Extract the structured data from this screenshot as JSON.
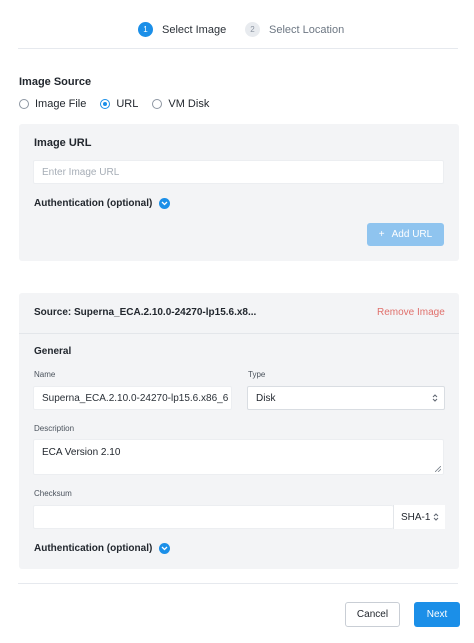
{
  "stepper": {
    "steps": [
      {
        "num": "1",
        "label": "Select Image",
        "state": "active"
      },
      {
        "num": "2",
        "label": "Select Location",
        "state": "inactive"
      }
    ]
  },
  "image_source": {
    "title": "Image Source",
    "options": [
      {
        "label": "Image File",
        "checked": false
      },
      {
        "label": "URL",
        "checked": true
      },
      {
        "label": "VM Disk",
        "checked": false
      }
    ]
  },
  "url_panel": {
    "title": "Image URL",
    "url_placeholder": "Enter Image URL",
    "url_value": "",
    "auth_label": "Authentication (optional)",
    "add_button_label": "Add URL",
    "add_button_icon": "plus-icon"
  },
  "image_item": {
    "source_label": "Source: Superna_ECA.2.10.0-24270-lp15.6.x8...",
    "remove_label": "Remove Image",
    "general_title": "General",
    "name_label": "Name",
    "name_value": "Superna_ECA.2.10.0-24270-lp15.6.x86_6",
    "type_label": "Type",
    "type_value": "Disk",
    "description_label": "Description",
    "description_value": "ECA Version 2.10",
    "checksum_label": "Checksum",
    "checksum_value": "",
    "checksum_algo": "SHA-1",
    "auth_label": "Authentication (optional)"
  },
  "footer": {
    "cancel_label": "Cancel",
    "next_label": "Next"
  },
  "colors": {
    "accent": "#1b8fe8",
    "accent_disabled": "#8fc4ef",
    "danger_link": "#e0706c",
    "panel_bg": "#f3f4f6"
  }
}
